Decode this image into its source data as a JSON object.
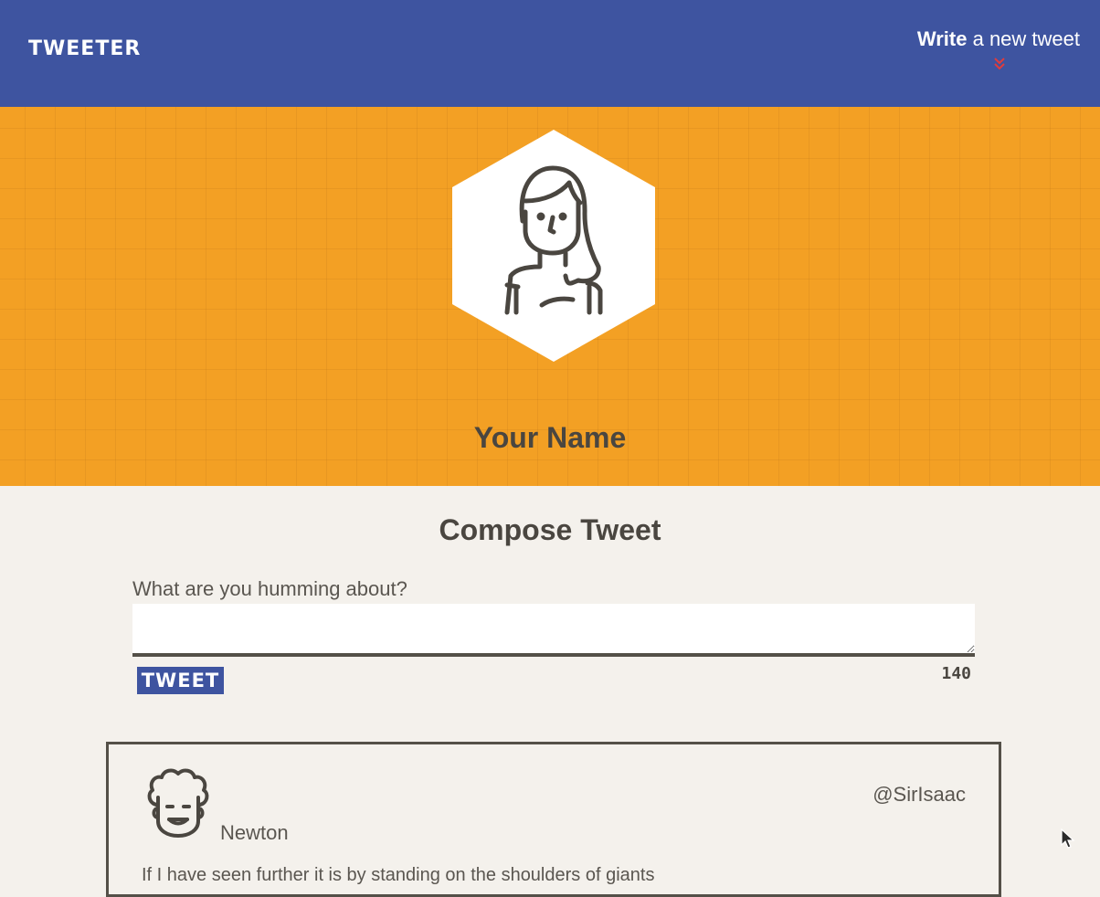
{
  "nav": {
    "brand": "TWEETER",
    "compose_toggle": {
      "strong": "Write",
      "light": " a new tweet"
    },
    "chevron_icon": "double-chevron-down",
    "chevron_color": "#e03c3c"
  },
  "header": {
    "name": "Your Name",
    "avatar_icon": "user-avatar-woman"
  },
  "compose": {
    "title": "Compose Tweet",
    "label": "What are you humming about?",
    "textarea_value": "",
    "button_label": "TWEET",
    "counter": "140"
  },
  "tweets": [
    {
      "name": "Newton",
      "handle": "@SirIsaac",
      "avatar_icon": "user-avatar-curly-hair",
      "text": "If I have seen further it is by standing on the shoulders of giants"
    }
  ],
  "colors": {
    "nav_bg": "#3e54a0",
    "header_bg": "#f3a024",
    "page_bg": "#f4f1ec",
    "text": "#4a4640"
  }
}
